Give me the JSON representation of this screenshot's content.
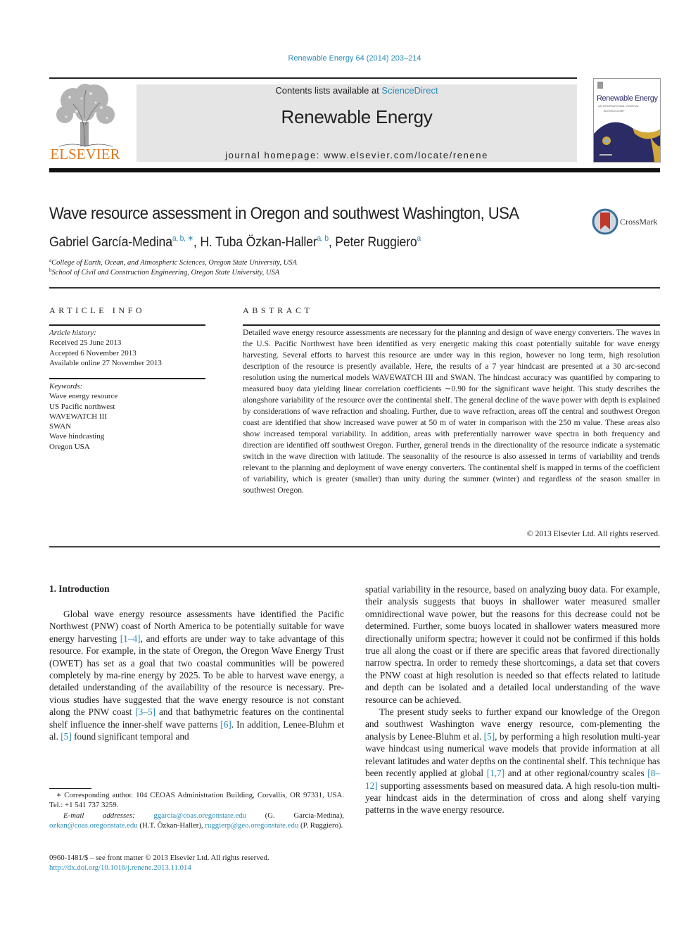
{
  "header": {
    "citation": "Renewable Energy 64 (2014) 203–214",
    "contents_prefix": "Contents lists available at ",
    "contents_link": "ScienceDirect",
    "journal_title": "Renewable Energy",
    "homepage": "journal homepage: www.elsevier.com/locate/renene",
    "publisher_logo_text": "ELSEVIER",
    "cover": {
      "title": "Renewable Energy",
      "subtitle": "AN INTERNATIONAL JOURNAL",
      "editor": "EDITOR-IN-CHIEF"
    }
  },
  "article": {
    "title": "Wave resource assessment in Oregon and southwest Washington, USA",
    "crossmark_label": "CrossMark",
    "authors": [
      {
        "name": "Gabriel García-Medina",
        "sup": "a, b, ∗"
      },
      {
        "name": "H. Tuba Özkan-Haller",
        "sup": "a, b"
      },
      {
        "name": "Peter Ruggiero",
        "sup": "a"
      }
    ],
    "author_separator": ", ",
    "affiliations": [
      {
        "mark": "a",
        "text": "College of Earth, Ocean, and Atmospheric Sciences, Oregon State University, USA"
      },
      {
        "mark": "b",
        "text": "School of Civil and Construction Engineering, Oregon State University, USA"
      }
    ]
  },
  "article_info": {
    "heading": "ARTICLE INFO",
    "history_label": "Article history:",
    "history": [
      "Received 25 June 2013",
      "Accepted 6 November 2013",
      "Available online 27 November 2013"
    ],
    "keywords_label": "Keywords:",
    "keywords": [
      "Wave energy resource",
      "US Pacific northwest",
      "WAVEWATCH III",
      "SWAN",
      "Wave hindcasting",
      "Oregon USA"
    ]
  },
  "abstract": {
    "heading": "ABSTRACT",
    "text": "Detailed wave energy resource assessments are necessary for the planning and design of wave energy converters. The waves in the U.S. Pacific Northwest have been identified as very energetic making this coast potentially suitable for wave energy harvesting. Several efforts to harvest this resource are under way in this region, however no long term, high resolution description of the resource is presently available. Here, the results of a 7 year hindcast are presented at a 30 arc-second resolution using the numerical models WAVEWATCH III and SWAN. The hindcast accuracy was quantified by comparing to measured buoy data yielding linear correlation coefficients ∼0.90 for the significant wave height. This study describes the alongshore variability of the resource over the continental shelf. The general decline of the wave power with depth is explained by considerations of wave refraction and shoaling. Further, due to wave refraction, areas off the central and southwest Oregon coast are identified that show increased wave power at 50 m of water in comparison with the 250 m value. These areas also show increased temporal variability. In addition, areas with preferentially narrower wave spectra in both frequency and direction are identified off southwest Oregon. Further, general trends in the directionality of the resource indicate a systematic switch in the wave direction with latitude. The seasonality of the resource is also assessed in terms of variability and trends relevant to the planning and deployment of wave energy converters. The continental shelf is mapped in terms of the coefficient of variability, which is greater (smaller) than unity during the summer (winter) and regardless of the season smaller in southwest Oregon.",
    "copyright": "© 2013 Elsevier Ltd. All rights reserved."
  },
  "body": {
    "section_title": "1.  Introduction",
    "left": {
      "p1": [
        {
          "t": "Global wave energy resource assessments have identified the Pacific Northwest (PNW) coast of North America to be potentially suitable for wave energy harvesting "
        },
        {
          "ref": "[1–4]"
        },
        {
          "t": ", and efforts are under way to take advantage of this resource. For example, in the state of Oregon, the Oregon Wave Energy Trust (OWET) has set as a goal that two coastal communities will be powered completely by ma-rine energy by 2025. To be able to harvest wave energy, a detailed understanding of the availability of the resource is necessary. Pre-vious studies have suggested that the wave energy resource is not constant along the PNW coast "
        },
        {
          "ref": "[3–5]"
        },
        {
          "t": " and that bathymetric features on the continental shelf influence the inner-shelf wave patterns "
        },
        {
          "ref": "[6]"
        },
        {
          "t": ". In addition, Lenee-Bluhm et al. "
        },
        {
          "ref": "[5]"
        },
        {
          "t": " found significant temporal and"
        }
      ]
    },
    "right": {
      "p1": "spatial variability in the resource, based on analyzing buoy data. For example, their analysis suggests that buoys in shallower water measured smaller omnidirectional wave power, but the reasons for this decrease could not be determined. Further, some buoys located in shallower waters measured more directionally uniform spectra; however it could not be confirmed if this holds true all along the coast or if there are specific areas that favored directionally narrow spectra. In order to remedy these shortcomings, a data set that covers the PNW coast at high resolution is needed so that effects related to latitude and depth can be isolated and a detailed local understanding of the wave resource can be achieved.",
      "p2": [
        {
          "t": "The present study seeks to further expand our knowledge of the Oregon and southwest Washington wave energy resource, com-plementing the analysis by Lenee-Bluhm et al. "
        },
        {
          "ref": "[5]"
        },
        {
          "t": ", by performing a high resolution multi-year wave hindcast using numerical wave models that provide information at all relevant latitudes and water depths on the continental shelf. This technique has been recently applied at global "
        },
        {
          "ref": "[1,7]"
        },
        {
          "t": " and at other regional/country scales "
        },
        {
          "ref": "[8–12]"
        },
        {
          "t": " supporting assessments based on measured data. A high resolu-tion multi-year hindcast aids in the determination of cross and along shelf varying patterns in the wave energy resource."
        }
      ]
    }
  },
  "footnotes": {
    "corresponding": "∗ Corresponding author. 104 CEOAS Administration Building, Corvallis, OR 97331, USA. Tel.: +1 541 737 3259.",
    "email_label": "E-mail addresses:",
    "emails": [
      {
        "address": "ggarcia@coas.oregonstate.edu",
        "who": " (G. García-Medina), "
      },
      {
        "address": "ozkan@coas.oregonstate.edu",
        "who": " (H.T. Özkan-Haller), "
      },
      {
        "address": "ruggierp@geo.oregonstate.edu",
        "who": " (P. Ruggiero)."
      }
    ],
    "front_matter": "0960-1481/$ – see front matter © 2013 Elsevier Ltd. All rights reserved.",
    "doi": "http://dx.doi.org/10.1016/j.renene.2013.11.014"
  },
  "colors": {
    "link": "#2a8ab5",
    "elsevier_orange": "#e07a1f",
    "banner_gray": "#e5e5e5",
    "cover_navy": "#2b2b66",
    "cover_gold": "#d4a838"
  }
}
